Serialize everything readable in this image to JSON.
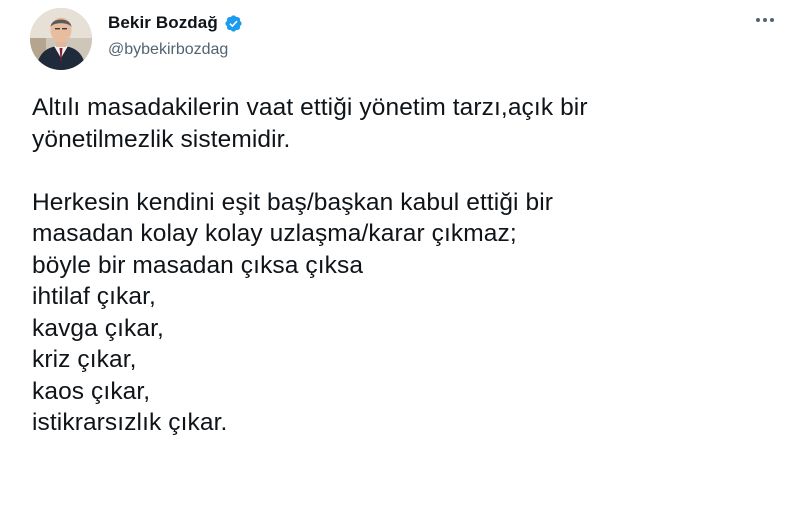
{
  "author": {
    "display_name": "Bekir Bozdağ",
    "handle": "@bybekirbozdag",
    "verified": true,
    "verified_color": "#1d9bf0"
  },
  "icons": {
    "verified": "verified-badge-icon",
    "more": "more-options-icon"
  },
  "tweet": {
    "paragraph1": [
      "Altılı masadakilerin vaat ettiği yönetim tarzı,açık bir",
      "yönetilmezlik sistemidir."
    ],
    "paragraph2": [
      "Herkesin kendini eşit baş/başkan kabul ettiği bir",
      "masadan kolay kolay uzlaşma/karar çıkmaz;",
      "böyle bir masadan çıksa çıksa",
      "ihtilaf çıkar,",
      "kavga çıkar,",
      "kriz çıkar,",
      "kaos çıkar,",
      "istikrarsızlık çıkar."
    ]
  }
}
